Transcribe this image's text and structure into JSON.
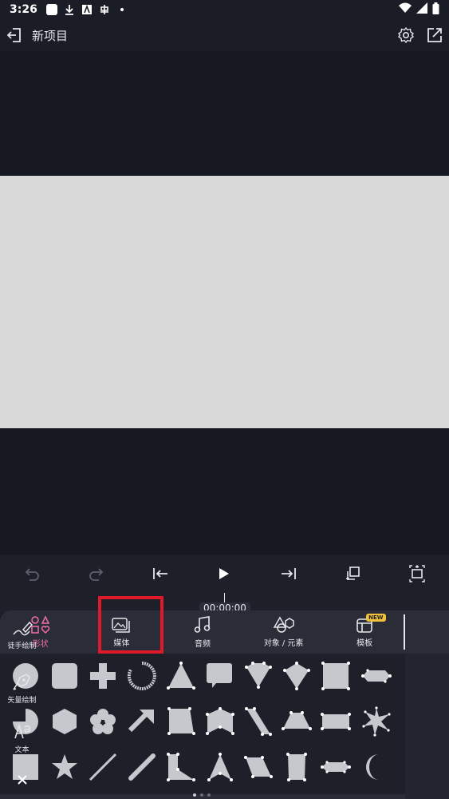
{
  "status_bar": {
    "time": "3:26"
  },
  "header": {
    "title": "新项目"
  },
  "timeline": {
    "timecode": "00:00:00"
  },
  "tabs": [
    {
      "label": "形状",
      "icon": "shapes-icon",
      "active": true
    },
    {
      "label": "媒体",
      "icon": "media-icon",
      "active": false
    },
    {
      "label": "音频",
      "icon": "audio-icon",
      "active": false
    },
    {
      "label": "对象 / 元素",
      "icon": "objects-icon",
      "active": false
    },
    {
      "label": "模板",
      "icon": "template-icon",
      "active": false,
      "badge": "NEW"
    }
  ],
  "side_tools": [
    {
      "label": "徒手绘制",
      "icon": "freehand-draw-icon"
    },
    {
      "label": "矢量绘制",
      "icon": "vector-pen-icon"
    },
    {
      "label": "文本",
      "icon": "text-icon"
    }
  ],
  "shapes": [
    "circle",
    "rounded-square",
    "plus",
    "ring",
    "triangle",
    "speech-bubble",
    "gem",
    "kite",
    "square-points",
    "line-shape",
    "pie",
    "hexagon",
    "flower",
    "arrow",
    "trapezoid",
    "pentagon-house",
    "parallelogram-tall",
    "trapezoid-wide",
    "rectangle-points",
    "star-burst",
    "square",
    "star",
    "line",
    "thick-line",
    "l-shape",
    "arrowhead",
    "parallelogram",
    "rectangle-tall",
    "capsule",
    "crescent"
  ],
  "colors": {
    "accent": "#f06ea9",
    "highlight": "#e0192a",
    "badge": "#f2c23a",
    "canvas": "#d9d9d9",
    "shape_fill": "#c7c8ce"
  }
}
